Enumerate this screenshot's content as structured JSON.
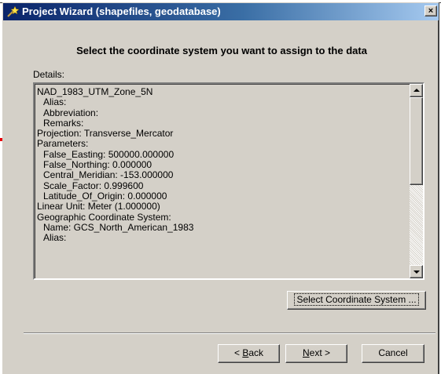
{
  "window": {
    "title": "Project Wizard (shapefiles, geodatabase)",
    "close_glyph": "×",
    "title_gradient_start": "#0a246a",
    "title_gradient_end": "#a6caf0"
  },
  "heading": "Select the coordinate system you want to assign to the data",
  "details": {
    "label": "Details:",
    "lines": [
      "NAD_1983_UTM_Zone_5N",
      "  Alias:",
      "  Abbreviation:",
      "  Remarks:",
      "Projection: Transverse_Mercator",
      "Parameters:",
      "  False_Easting: 500000.000000",
      "  False_Northing: 0.000000",
      "  Central_Meridian: -153.000000",
      "  Scale_Factor: 0.999600",
      "  Latitude_Of_Origin: 0.000000",
      "Linear Unit: Meter (1.000000)",
      "Geographic Coordinate System:",
      "  Name: GCS_North_American_1983",
      "  Alias:"
    ]
  },
  "buttons": {
    "select_coordinate_system": "Select Coordinate System ...",
    "back": "< Back",
    "next": "Next >",
    "cancel": "Cancel"
  },
  "annotation": {
    "arrow_color": "#e8000b"
  },
  "icons": {
    "app": "wizard-wand-icon",
    "close": "close-icon",
    "scroll_up": "scroll-up-arrow-icon",
    "scroll_down": "scroll-down-arrow-icon",
    "annotation": "red-pointer-arrow-icon"
  }
}
